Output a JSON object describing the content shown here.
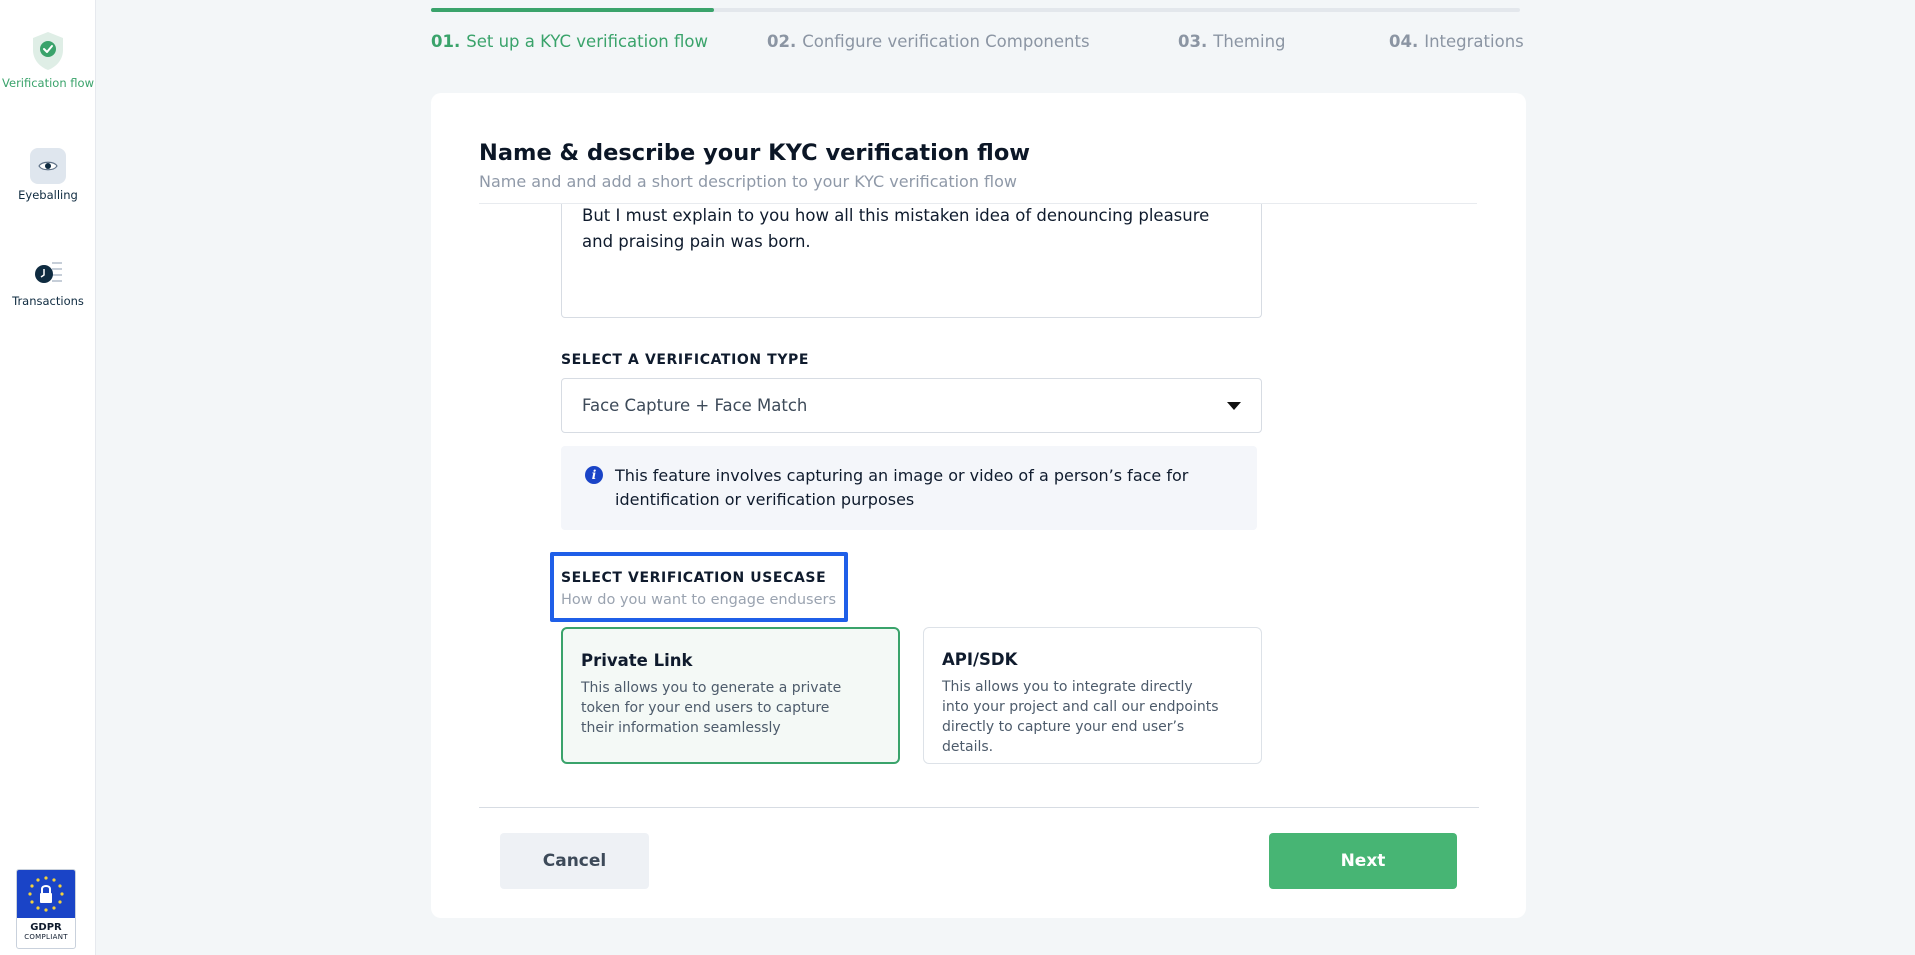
{
  "sidebar": {
    "items": [
      {
        "label": "Verification flow",
        "icon": "shield-check-icon",
        "active": true
      },
      {
        "label": "Eyeballing",
        "icon": "eye-icon",
        "active": false
      },
      {
        "label": "Transactions",
        "icon": "transactions-icon",
        "active": false
      }
    ],
    "badge": {
      "title": "GDPR",
      "subtitle": "COMPLIANT"
    }
  },
  "stepper": {
    "progress_fraction": 0.26,
    "steps": [
      {
        "num": "01.",
        "label": "Set up a KYC verification flow",
        "active": true
      },
      {
        "num": "02.",
        "label": "Configure verification Components",
        "active": false
      },
      {
        "num": "03.",
        "label": "Theming",
        "active": false
      },
      {
        "num": "04.",
        "label": "Integrations",
        "active": false
      }
    ]
  },
  "form": {
    "title": "Name & describe your KYC verification flow",
    "subtitle": "Name and and add a short description to your KYC verification flow",
    "description_text": "But I must explain to you how all this mistaken idea of denouncing pleasure and praising pain was born.",
    "type_label": "SELECT A VERIFICATION TYPE",
    "type_value": "Face Capture + Face Match",
    "info_text": "This feature involves capturing an image or video of a person’s face for identification or verification purposes",
    "usecase_label": "SELECT VERIFICATION USECASE",
    "usecase_sub": "How do you want to engage endusers",
    "options": [
      {
        "title": "Private Link",
        "desc": "This allows you to generate a private token for your end users to capture their information seamlessly",
        "selected": true
      },
      {
        "title": "API/SDK",
        "desc": "This allows you to integrate directly into your project and call our endpoints directly to capture your end user’s details.",
        "selected": false
      }
    ]
  },
  "footer": {
    "cancel_label": "Cancel",
    "next_label": "Next"
  },
  "colors": {
    "accent": "#3aa36b",
    "highlight": "#1f5fe8",
    "info_icon": "#1a44c7"
  }
}
